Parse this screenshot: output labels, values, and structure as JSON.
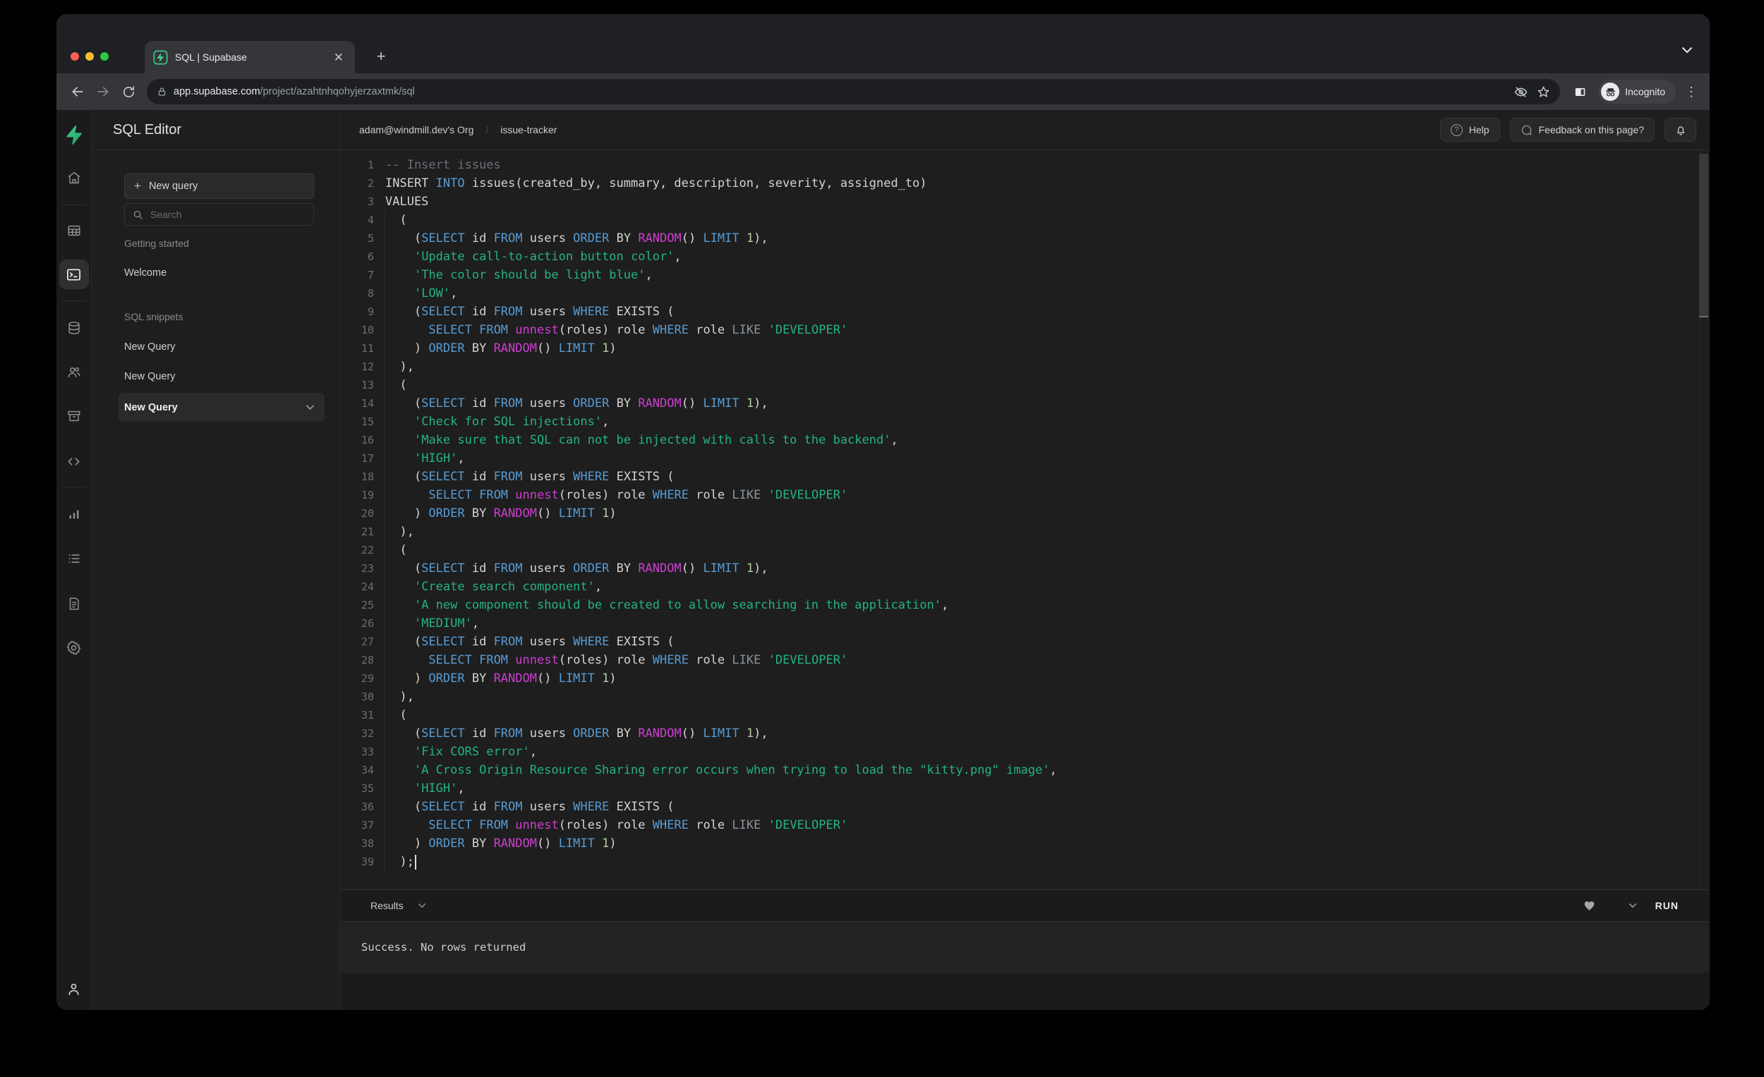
{
  "browser": {
    "tab_title": "SQL | Supabase",
    "url": {
      "host": "app.supabase.com",
      "path": "/project/azahtnhqohyjerzaxtmk/sql"
    },
    "incognito_label": "Incognito"
  },
  "rail": {
    "icons": [
      "supabase-logo",
      "home",
      "table-editor",
      "sql-editor",
      "database",
      "auth",
      "storage",
      "api",
      "reports",
      "logs",
      "docs",
      "settings",
      "account"
    ],
    "active": "sql-editor"
  },
  "sidebar": {
    "title": "SQL Editor",
    "new_query_button": "New query",
    "search_placeholder": "Search",
    "getting_started": {
      "label": "Getting started",
      "items": [
        "Welcome"
      ]
    },
    "sql_snippets": {
      "label": "SQL snippets",
      "items": [
        "New Query",
        "New Query"
      ]
    },
    "active_snippet": "New Query"
  },
  "header": {
    "breadcrumb_org": "adam@windmill.dev's Org",
    "breadcrumb_project": "issue-tracker",
    "help_label": "Help",
    "feedback_label": "Feedback on this page?"
  },
  "results": {
    "label": "Results",
    "run_label": "RUN",
    "message": "Success. No rows returned"
  },
  "colors": {
    "accent": "#3ecf8e",
    "tokens": {
      "c": "#6a6f76",
      "k": "#569cd6",
      "f": "#cd3fd0",
      "s": "#24b47e",
      "p": "#d4d4d4",
      "n": "#b5cea8",
      "o": "#8b949e"
    }
  },
  "editor": {
    "caret_line": 39,
    "lines": [
      [
        [
          "c",
          "-- Insert issues"
        ]
      ],
      [
        [
          "p",
          "INSERT "
        ],
        [
          "k",
          "INTO"
        ],
        [
          "p",
          " issues(created_by, summary, description, severity, assigned_to)"
        ]
      ],
      [
        [
          "p",
          "VALUES"
        ]
      ],
      [
        [
          "p",
          "  ("
        ]
      ],
      [
        [
          "p",
          "    ("
        ],
        [
          "k",
          "SELECT"
        ],
        [
          "p",
          " id "
        ],
        [
          "k",
          "FROM"
        ],
        [
          "p",
          " users "
        ],
        [
          "k",
          "ORDER"
        ],
        [
          "p",
          " BY "
        ],
        [
          "f",
          "RANDOM"
        ],
        [
          "p",
          "() "
        ],
        [
          "k",
          "LIMIT"
        ],
        [
          "p",
          " "
        ],
        [
          "n",
          "1"
        ],
        [
          "p",
          "),"
        ]
      ],
      [
        [
          "p",
          "    "
        ],
        [
          "s",
          "'Update call-to-action button color'"
        ],
        [
          "p",
          ","
        ]
      ],
      [
        [
          "p",
          "    "
        ],
        [
          "s",
          "'The color should be light blue'"
        ],
        [
          "p",
          ","
        ]
      ],
      [
        [
          "p",
          "    "
        ],
        [
          "s",
          "'LOW'"
        ],
        [
          "p",
          ","
        ]
      ],
      [
        [
          "p",
          "    ("
        ],
        [
          "k",
          "SELECT"
        ],
        [
          "p",
          " id "
        ],
        [
          "k",
          "FROM"
        ],
        [
          "p",
          " users "
        ],
        [
          "k",
          "WHERE"
        ],
        [
          "p",
          " EXISTS ("
        ]
      ],
      [
        [
          "p",
          "      "
        ],
        [
          "k",
          "SELECT"
        ],
        [
          "p",
          " "
        ],
        [
          "k",
          "FROM"
        ],
        [
          "p",
          " "
        ],
        [
          "f",
          "unnest"
        ],
        [
          "p",
          "(roles) role "
        ],
        [
          "k",
          "WHERE"
        ],
        [
          "p",
          " role "
        ],
        [
          "o",
          "LIKE"
        ],
        [
          "p",
          " "
        ],
        [
          "s",
          "'DEVELOPER'"
        ]
      ],
      [
        [
          "p",
          "    ) "
        ],
        [
          "k",
          "ORDER"
        ],
        [
          "p",
          " BY "
        ],
        [
          "f",
          "RANDOM"
        ],
        [
          "p",
          "() "
        ],
        [
          "k",
          "LIMIT"
        ],
        [
          "p",
          " "
        ],
        [
          "n",
          "1"
        ],
        [
          "p",
          ")"
        ]
      ],
      [
        [
          "p",
          "  ),"
        ]
      ],
      [
        [
          "p",
          "  ("
        ]
      ],
      [
        [
          "p",
          "    ("
        ],
        [
          "k",
          "SELECT"
        ],
        [
          "p",
          " id "
        ],
        [
          "k",
          "FROM"
        ],
        [
          "p",
          " users "
        ],
        [
          "k",
          "ORDER"
        ],
        [
          "p",
          " BY "
        ],
        [
          "f",
          "RANDOM"
        ],
        [
          "p",
          "() "
        ],
        [
          "k",
          "LIMIT"
        ],
        [
          "p",
          " "
        ],
        [
          "n",
          "1"
        ],
        [
          "p",
          "),"
        ]
      ],
      [
        [
          "p",
          "    "
        ],
        [
          "s",
          "'Check for SQL injections'"
        ],
        [
          "p",
          ","
        ]
      ],
      [
        [
          "p",
          "    "
        ],
        [
          "s",
          "'Make sure that SQL can not be injected with calls to the backend'"
        ],
        [
          "p",
          ","
        ]
      ],
      [
        [
          "p",
          "    "
        ],
        [
          "s",
          "'HIGH'"
        ],
        [
          "p",
          ","
        ]
      ],
      [
        [
          "p",
          "    ("
        ],
        [
          "k",
          "SELECT"
        ],
        [
          "p",
          " id "
        ],
        [
          "k",
          "FROM"
        ],
        [
          "p",
          " users "
        ],
        [
          "k",
          "WHERE"
        ],
        [
          "p",
          " EXISTS ("
        ]
      ],
      [
        [
          "p",
          "      "
        ],
        [
          "k",
          "SELECT"
        ],
        [
          "p",
          " "
        ],
        [
          "k",
          "FROM"
        ],
        [
          "p",
          " "
        ],
        [
          "f",
          "unnest"
        ],
        [
          "p",
          "(roles) role "
        ],
        [
          "k",
          "WHERE"
        ],
        [
          "p",
          " role "
        ],
        [
          "o",
          "LIKE"
        ],
        [
          "p",
          " "
        ],
        [
          "s",
          "'DEVELOPER'"
        ]
      ],
      [
        [
          "p",
          "    ) "
        ],
        [
          "k",
          "ORDER"
        ],
        [
          "p",
          " BY "
        ],
        [
          "f",
          "RANDOM"
        ],
        [
          "p",
          "() "
        ],
        [
          "k",
          "LIMIT"
        ],
        [
          "p",
          " "
        ],
        [
          "n",
          "1"
        ],
        [
          "p",
          ")"
        ]
      ],
      [
        [
          "p",
          "  ),"
        ]
      ],
      [
        [
          "p",
          "  ("
        ]
      ],
      [
        [
          "p",
          "    ("
        ],
        [
          "k",
          "SELECT"
        ],
        [
          "p",
          " id "
        ],
        [
          "k",
          "FROM"
        ],
        [
          "p",
          " users "
        ],
        [
          "k",
          "ORDER"
        ],
        [
          "p",
          " BY "
        ],
        [
          "f",
          "RANDOM"
        ],
        [
          "p",
          "() "
        ],
        [
          "k",
          "LIMIT"
        ],
        [
          "p",
          " "
        ],
        [
          "n",
          "1"
        ],
        [
          "p",
          "),"
        ]
      ],
      [
        [
          "p",
          "    "
        ],
        [
          "s",
          "'Create search component'"
        ],
        [
          "p",
          ","
        ]
      ],
      [
        [
          "p",
          "    "
        ],
        [
          "s",
          "'A new component should be created to allow searching in the application'"
        ],
        [
          "p",
          ","
        ]
      ],
      [
        [
          "p",
          "    "
        ],
        [
          "s",
          "'MEDIUM'"
        ],
        [
          "p",
          ","
        ]
      ],
      [
        [
          "p",
          "    ("
        ],
        [
          "k",
          "SELECT"
        ],
        [
          "p",
          " id "
        ],
        [
          "k",
          "FROM"
        ],
        [
          "p",
          " users "
        ],
        [
          "k",
          "WHERE"
        ],
        [
          "p",
          " EXISTS ("
        ]
      ],
      [
        [
          "p",
          "      "
        ],
        [
          "k",
          "SELECT"
        ],
        [
          "p",
          " "
        ],
        [
          "k",
          "FROM"
        ],
        [
          "p",
          " "
        ],
        [
          "f",
          "unnest"
        ],
        [
          "p",
          "(roles) role "
        ],
        [
          "k",
          "WHERE"
        ],
        [
          "p",
          " role "
        ],
        [
          "o",
          "LIKE"
        ],
        [
          "p",
          " "
        ],
        [
          "s",
          "'DEVELOPER'"
        ]
      ],
      [
        [
          "p",
          "    ) "
        ],
        [
          "k",
          "ORDER"
        ],
        [
          "p",
          " BY "
        ],
        [
          "f",
          "RANDOM"
        ],
        [
          "p",
          "() "
        ],
        [
          "k",
          "LIMIT"
        ],
        [
          "p",
          " "
        ],
        [
          "n",
          "1"
        ],
        [
          "p",
          ")"
        ]
      ],
      [
        [
          "p",
          "  ),"
        ]
      ],
      [
        [
          "p",
          "  ("
        ]
      ],
      [
        [
          "p",
          "    ("
        ],
        [
          "k",
          "SELECT"
        ],
        [
          "p",
          " id "
        ],
        [
          "k",
          "FROM"
        ],
        [
          "p",
          " users "
        ],
        [
          "k",
          "ORDER"
        ],
        [
          "p",
          " BY "
        ],
        [
          "f",
          "RANDOM"
        ],
        [
          "p",
          "() "
        ],
        [
          "k",
          "LIMIT"
        ],
        [
          "p",
          " "
        ],
        [
          "n",
          "1"
        ],
        [
          "p",
          "),"
        ]
      ],
      [
        [
          "p",
          "    "
        ],
        [
          "s",
          "'Fix CORS error'"
        ],
        [
          "p",
          ","
        ]
      ],
      [
        [
          "p",
          "    "
        ],
        [
          "s",
          "'A Cross Origin Resource Sharing error occurs when trying to load the \"kitty.png\" image'"
        ],
        [
          "p",
          ","
        ]
      ],
      [
        [
          "p",
          "    "
        ],
        [
          "s",
          "'HIGH'"
        ],
        [
          "p",
          ","
        ]
      ],
      [
        [
          "p",
          "    ("
        ],
        [
          "k",
          "SELECT"
        ],
        [
          "p",
          " id "
        ],
        [
          "k",
          "FROM"
        ],
        [
          "p",
          " users "
        ],
        [
          "k",
          "WHERE"
        ],
        [
          "p",
          " EXISTS ("
        ]
      ],
      [
        [
          "p",
          "      "
        ],
        [
          "k",
          "SELECT"
        ],
        [
          "p",
          " "
        ],
        [
          "k",
          "FROM"
        ],
        [
          "p",
          " "
        ],
        [
          "f",
          "unnest"
        ],
        [
          "p",
          "(roles) role "
        ],
        [
          "k",
          "WHERE"
        ],
        [
          "p",
          " role "
        ],
        [
          "o",
          "LIKE"
        ],
        [
          "p",
          " "
        ],
        [
          "s",
          "'DEVELOPER'"
        ]
      ],
      [
        [
          "p",
          "    ) "
        ],
        [
          "k",
          "ORDER"
        ],
        [
          "p",
          " BY "
        ],
        [
          "f",
          "RANDOM"
        ],
        [
          "p",
          "() "
        ],
        [
          "k",
          "LIMIT"
        ],
        [
          "p",
          " "
        ],
        [
          "n",
          "1"
        ],
        [
          "p",
          ")"
        ]
      ],
      [
        [
          "p",
          "  );"
        ]
      ]
    ]
  }
}
